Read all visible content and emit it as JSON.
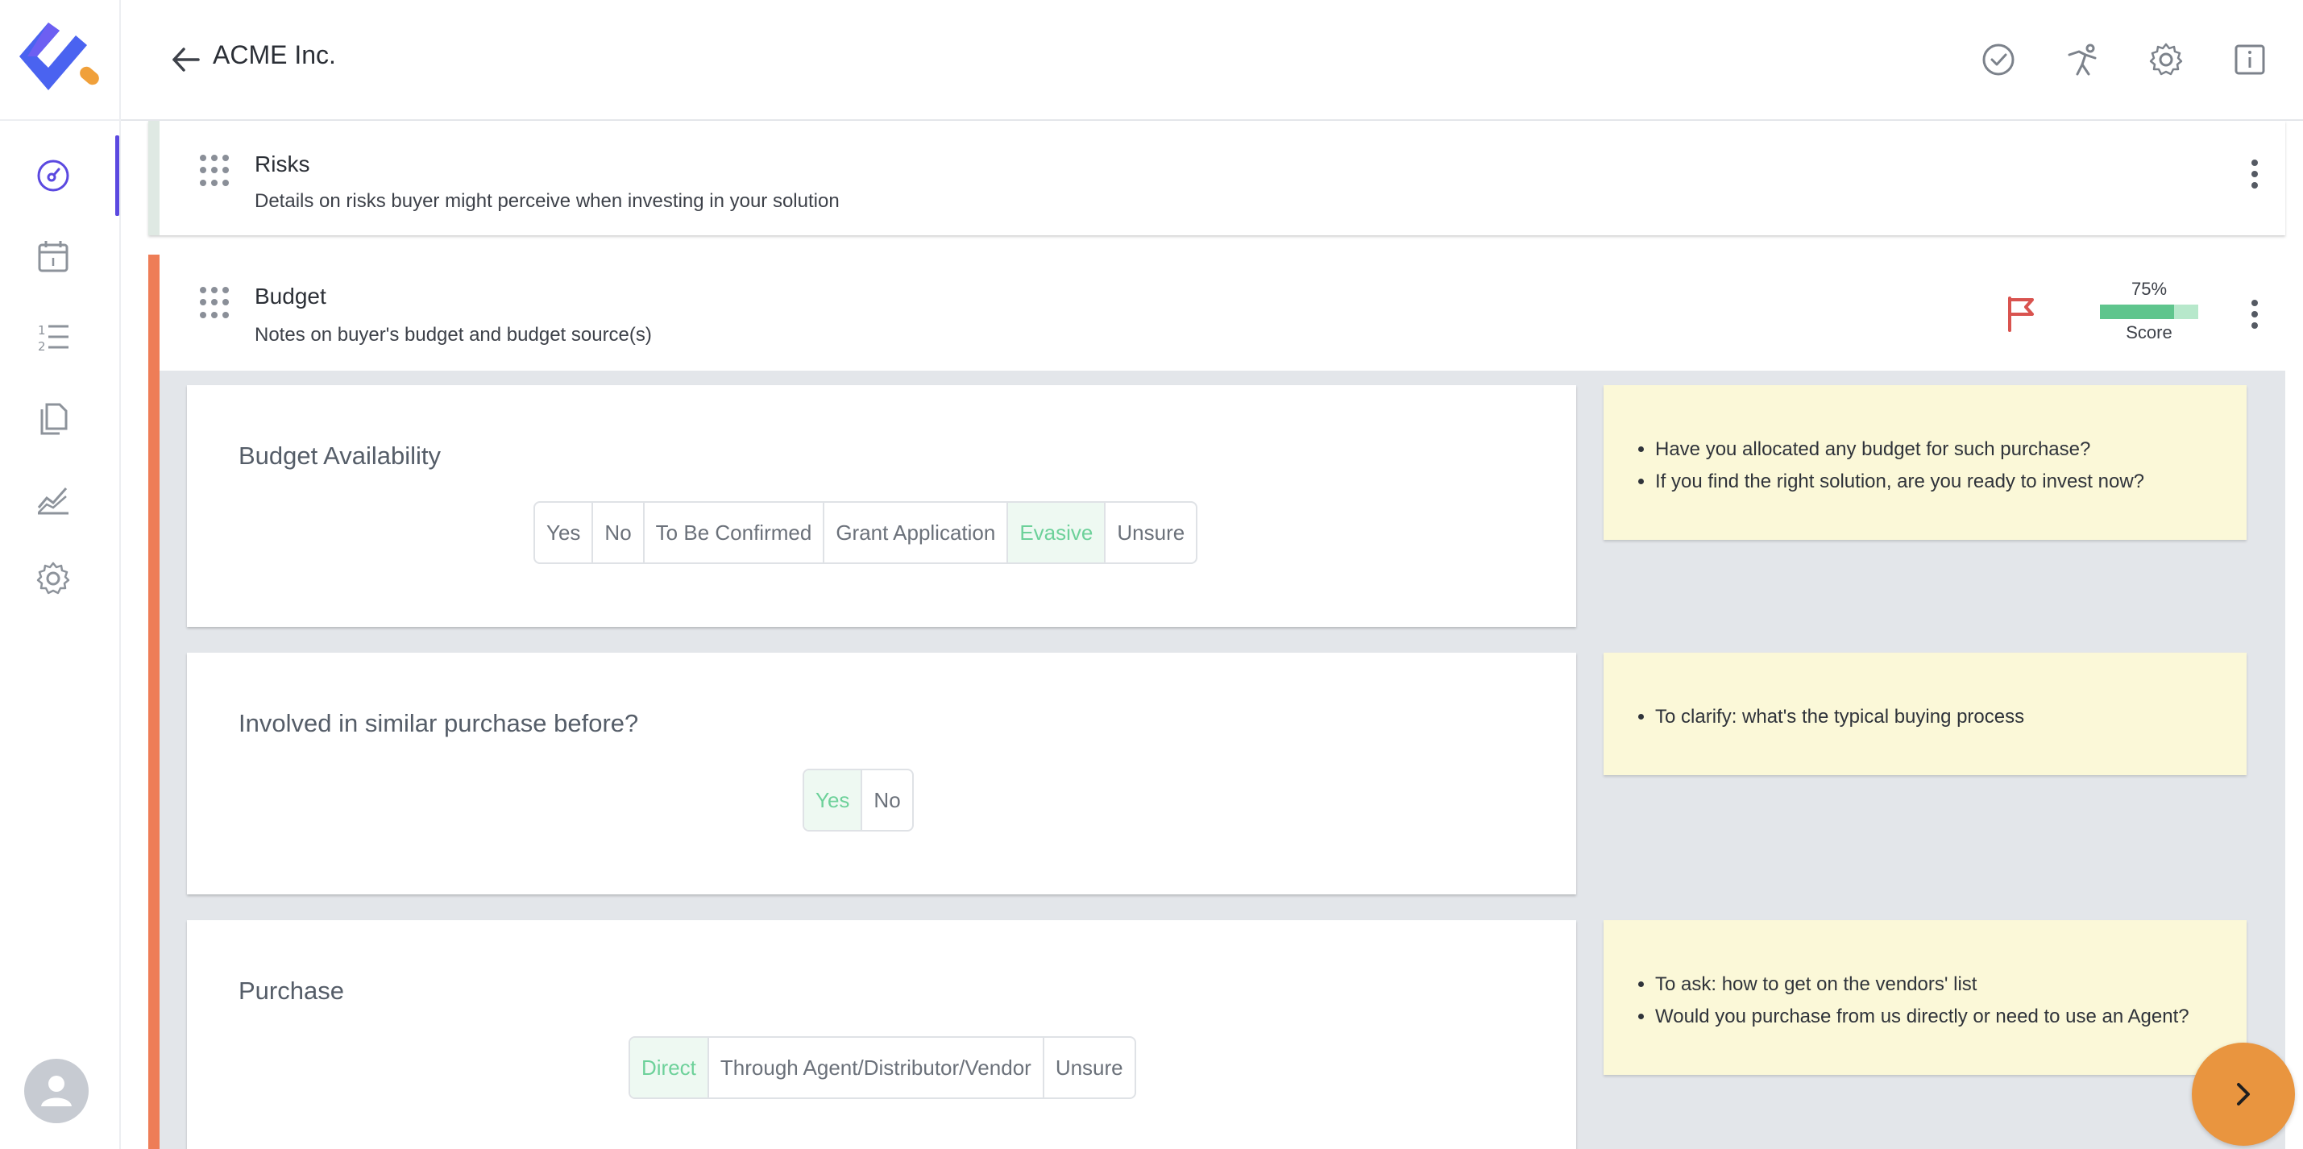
{
  "app": {
    "company_name": "ACME Inc.",
    "accent_color": "#5b49e0",
    "brand_blue": "#4a63f0",
    "brand_orange": "#f0a03a"
  },
  "sidebar": {
    "items": [
      {
        "icon": "dashboard-icon",
        "active": true
      },
      {
        "icon": "calendar-icon",
        "active": false
      },
      {
        "icon": "numbered-list-icon",
        "active": false
      },
      {
        "icon": "documents-icon",
        "active": false
      },
      {
        "icon": "analytics-chart-icon",
        "active": false
      },
      {
        "icon": "gear-icon",
        "active": false
      }
    ],
    "user_icon": "user-avatar-icon"
  },
  "header": {
    "actions": [
      "check-circle-icon",
      "kickstart-icon",
      "gear-icon",
      "info-icon"
    ]
  },
  "sections": {
    "risks": {
      "title": "Risks",
      "description": "Details on risks buyer might perceive when investing in your solution",
      "accent_color": "#dfe9e3"
    },
    "budget": {
      "title": "Budget",
      "description": "Notes on buyer's budget and budget source(s)",
      "accent_color": "#ee7d57",
      "flag_color": "#d9534f",
      "score_percent": "75%",
      "score_value": 0.75,
      "score_label": "Score"
    }
  },
  "questions": [
    {
      "title": "Budget Availability",
      "options": [
        "Yes",
        "No",
        "To Be Confirmed",
        "Grant Application",
        "Evasive",
        "Unsure"
      ],
      "selected": "Evasive",
      "notes": [
        "Have you allocated any budget for such purchase?",
        "If you find the right solution, are you ready to invest now?"
      ]
    },
    {
      "title": "Involved in similar purchase before?",
      "options": [
        "Yes",
        "No"
      ],
      "selected": "Yes",
      "notes": [
        "To clarify: what's the typical buying process"
      ]
    },
    {
      "title": "Purchase",
      "options": [
        "Direct",
        "Through Agent/Distributor/Vendor",
        "Unsure"
      ],
      "selected": "Direct",
      "notes": [
        "To ask: how to get on the vendors' list",
        "Would you purchase from us directly or need to use an Agent?"
      ]
    }
  ],
  "fab": {
    "icon": "chevron-right-icon",
    "color": "#e9953f"
  }
}
